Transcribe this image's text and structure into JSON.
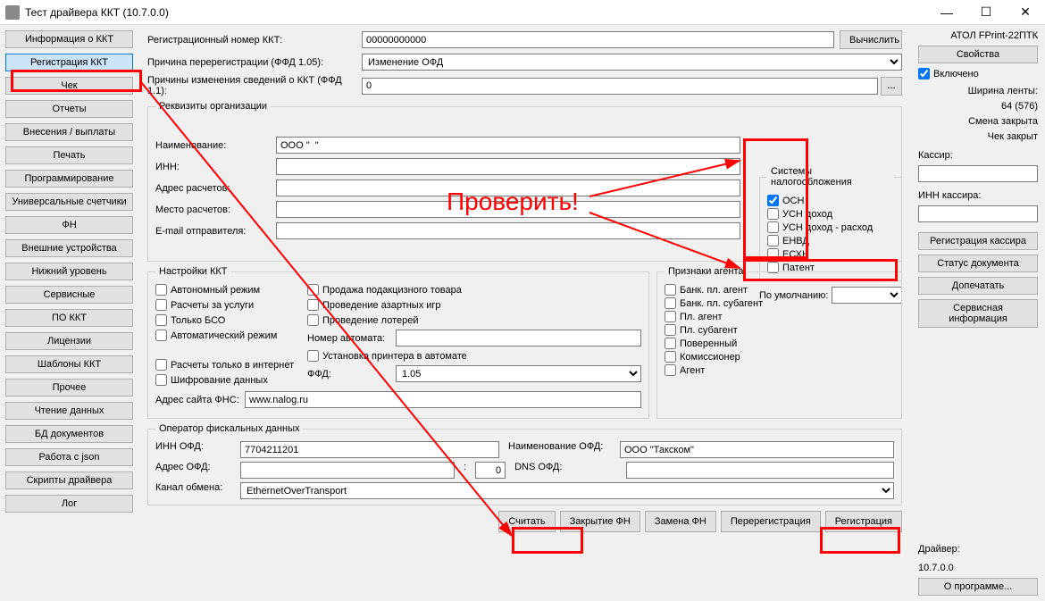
{
  "window": {
    "title": "Тест драйвера ККТ (10.7.0.0)"
  },
  "nav": {
    "items": [
      "Информация о ККТ",
      "Регистрация ККТ",
      "Чек",
      "Отчеты",
      "Внесения / выплаты",
      "Печать",
      "Программирование",
      "Универсальные счетчики",
      "ФН",
      "Внешние устройства",
      "Нижний уровень",
      "Сервисные",
      "ПО ККТ",
      "Лицензии",
      "Шаблоны ККТ",
      "Прочее",
      "Чтение данных",
      "БД документов",
      "Работа с json",
      "Скрипты драйвера",
      "Лог"
    ],
    "active_index": 1
  },
  "top": {
    "reg_num_label": "Регистрационный номер ККТ:",
    "reg_num_value": "00000000000",
    "calc_btn": "Вычислить",
    "reason_label": "Причина перерегистрации (ФФД 1.05):",
    "reason_value": "Изменение ОФД",
    "reasons11_label": "Причины изменения сведений о ККТ (ФФД 1.1):",
    "reasons11_value": "0",
    "dots_btn": "..."
  },
  "org": {
    "legend": "Реквизиты организации",
    "name_label": "Наименование:",
    "name_value": "ООО \"  \"",
    "inn_label": "ИНН:",
    "inn_value": "",
    "addr_label": "Адрес расчетов:",
    "addr_value": "",
    "place_label": "Место расчетов:",
    "place_value": "",
    "email_label": "E-mail отправителя:",
    "email_value": ""
  },
  "tax": {
    "legend": "Системы налогообложения",
    "items": [
      "ОСН",
      "УСН доход",
      "УСН доход - расход",
      "ЕНВД",
      "ЕСХН",
      "Патент"
    ],
    "checked": [
      true,
      false,
      false,
      false,
      false,
      false
    ],
    "default_label": "По умолчанию:",
    "default_value": ""
  },
  "settings": {
    "legend": "Настройки ККТ",
    "col1": [
      "Автономный режим",
      "Расчеты за услуги",
      "Только БСО",
      "Автоматический режим",
      "",
      "Расчеты только в интернет",
      "Шифрование данных"
    ],
    "col2": [
      "Продажа подакцизного товара",
      "Проведение азартных игр",
      "Проведение лотерей"
    ],
    "automat_label": "Номер автомата:",
    "automat_value": "",
    "printer_label": "Установка принтера в автомате",
    "ffd_label": "ФФД:",
    "ffd_value": "1.05",
    "fns_label": "Адрес сайта ФНС:",
    "fns_value": "www.nalog.ru"
  },
  "agent": {
    "legend": "Признаки агента",
    "items": [
      "Банк. пл. агент",
      "Банк. пл. субагент",
      "Пл. агент",
      "Пл. субагент",
      "Поверенный",
      "Комиссионер",
      "Агент"
    ]
  },
  "ofd": {
    "legend": "Оператор фискальных данных",
    "inn_label": "ИНН ОФД:",
    "inn_value": "7704211201",
    "name_label": "Наименование ОФД:",
    "name_value": "ООО \"Такском\"",
    "addr_label": "Адрес ОФД:",
    "addr_value": "",
    "port_value": "0",
    "dns_label": "DNS ОФД:",
    "dns_value": "",
    "channel_label": "Канал обмена:",
    "channel_value": "EthernetOverTransport"
  },
  "bottom_buttons": [
    "Считать",
    "Закрытие ФН",
    "Замена ФН",
    "Перерегистрация",
    "Регистрация"
  ],
  "right": {
    "device": "АТОЛ FPrint-22ПТК",
    "props_btn": "Свойства",
    "enabled_label": "Включено",
    "width_label": "Ширина ленты:",
    "width_value": "64 (576)",
    "shift_label": "Смена закрыта",
    "check_label": "Чек закрыт",
    "cashier_label": "Кассир:",
    "cashier_value": "",
    "cashier_inn_label": "ИНН кассира:",
    "cashier_inn_value": "",
    "reg_cashier_btn": "Регистрация кассира",
    "doc_status_btn": "Статус документа",
    "reprint_btn": "Допечатать",
    "service_btn": "Сервисная информация",
    "driver_label": "Драйвер:",
    "driver_version": "10.7.0.0",
    "about_btn": "О программе..."
  },
  "annotation": {
    "text": "Проверить!"
  }
}
